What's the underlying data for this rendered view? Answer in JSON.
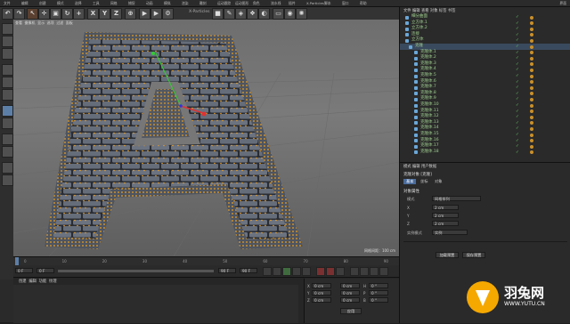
{
  "app": {
    "title": "X-Particles",
    "mode_label": "界面"
  },
  "menubar": {
    "items": [
      "文件",
      "编辑",
      "创建",
      "模式",
      "选择",
      "工具",
      "网格",
      "捕捉",
      "动画",
      "模拟",
      "渲染",
      "雕刻",
      "运动跟踪",
      "运动图形",
      "角色",
      "流水线",
      "插件",
      "X-Particles",
      "脚本",
      "窗口",
      "帮助"
    ]
  },
  "toolbar": {
    "buttons": [
      "X",
      "Y",
      "Z"
    ]
  },
  "viewport": {
    "menu": [
      "查看",
      "摄像机",
      "显示",
      "选项",
      "过滤",
      "面板",
      "ProRender"
    ],
    "grid_label": "网格间距：100 cm"
  },
  "timeline": {
    "ticks": [
      "0",
      "10",
      "20",
      "30",
      "40",
      "50",
      "60",
      "70",
      "80",
      "90"
    ],
    "frame_start": "0 F",
    "frame_current": "0 F",
    "frame_end": "90 F",
    "frame_end2": "90 F"
  },
  "bottom": {
    "tabs": [
      "创建",
      "编辑",
      "功能",
      "纹理"
    ],
    "coord_labels": [
      "X",
      "Y",
      "Z"
    ],
    "coord_values": [
      "0 cm",
      "0 cm",
      "0 cm"
    ],
    "size_values": [
      "0 cm",
      "0 cm",
      "0 cm"
    ],
    "rot_labels": [
      "H",
      "P",
      "B"
    ],
    "rot_values": [
      "0 °",
      "0 °",
      "0 °"
    ],
    "apply_label": "应用"
  },
  "object_manager": {
    "menu": [
      "文件",
      "编辑",
      "查看",
      "对象",
      "标签",
      "书签"
    ],
    "items": [
      "细分曲面",
      "立方体.1",
      "立方体.2",
      "连接",
      "立方体",
      "克隆",
      "克隆体.1",
      "克隆体.2",
      "克隆体.3",
      "克隆体.4",
      "克隆体.5",
      "克隆体.6",
      "克隆体.7",
      "克隆体.8",
      "克隆体.9",
      "克隆体.10",
      "克隆体.11",
      "克隆体.12",
      "克隆体.13",
      "克隆体.14",
      "克隆体.15",
      "克隆体.16",
      "克隆体.17",
      "克隆体.18"
    ]
  },
  "attribute_manager": {
    "menu": [
      "模式",
      "编辑",
      "用户数据"
    ],
    "title": "克隆对象 [克隆]",
    "tabs": [
      "基本",
      "坐标",
      "对象"
    ],
    "section": "对象属性",
    "fields": [
      {
        "label": "模式",
        "value": "网格排列"
      },
      {
        "label": "X",
        "value": "2 cm"
      },
      {
        "label": "Y",
        "value": "2 cm"
      },
      {
        "label": "Z",
        "value": "2 cm"
      },
      {
        "label": "实例模式",
        "value": "实例"
      }
    ],
    "buttons": [
      "加载预置",
      "保存预置"
    ]
  },
  "watermark": {
    "brand": "羽兔网",
    "url": "WWW.YUTU.CN"
  },
  "colors": {
    "accent": "#f0a020",
    "selection": "#4a6c9c",
    "green": "#9fcf8f"
  }
}
